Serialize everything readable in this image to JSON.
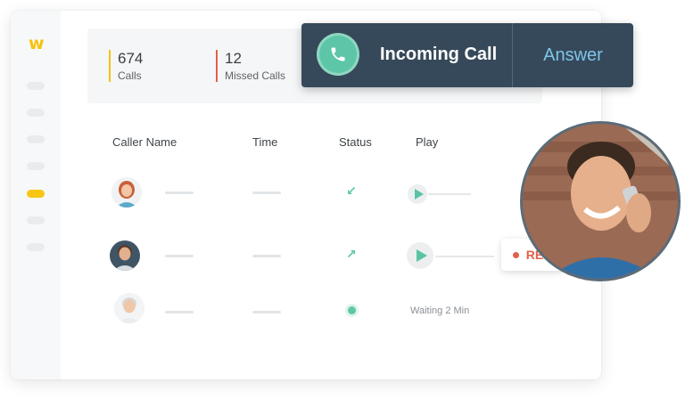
{
  "app": {
    "logo": "w"
  },
  "sidebar": {
    "items": [
      "nav-1",
      "nav-2",
      "nav-3",
      "nav-4",
      "nav-5",
      "nav-6",
      "nav-7"
    ],
    "active_index": 4
  },
  "stats": [
    {
      "value": "674",
      "label": "Calls",
      "accent": "#f6c20c"
    },
    {
      "value": "12",
      "label": "Missed Calls",
      "accent": "#e2604b"
    }
  ],
  "table": {
    "headers": {
      "name": "Caller Name",
      "time": "Time",
      "status": "Status",
      "play": "Play"
    },
    "rows": [
      {
        "status": "incoming",
        "status_icon": "↙",
        "play": "player"
      },
      {
        "status": "outgoing",
        "status_icon": "↗",
        "play": "player"
      },
      {
        "status": "waiting",
        "status_icon": "dot",
        "play_text": "Waiting 2 Min"
      }
    ]
  },
  "incoming_call": {
    "title": "Incoming Call",
    "action": "Answer"
  },
  "recording": {
    "label": "REC"
  },
  "colors": {
    "accent_green": "#5ec6a8",
    "banner": "#36495a",
    "answer": "#7fc4ea",
    "rec": "#e2604b",
    "active_nav": "#f7c614"
  }
}
